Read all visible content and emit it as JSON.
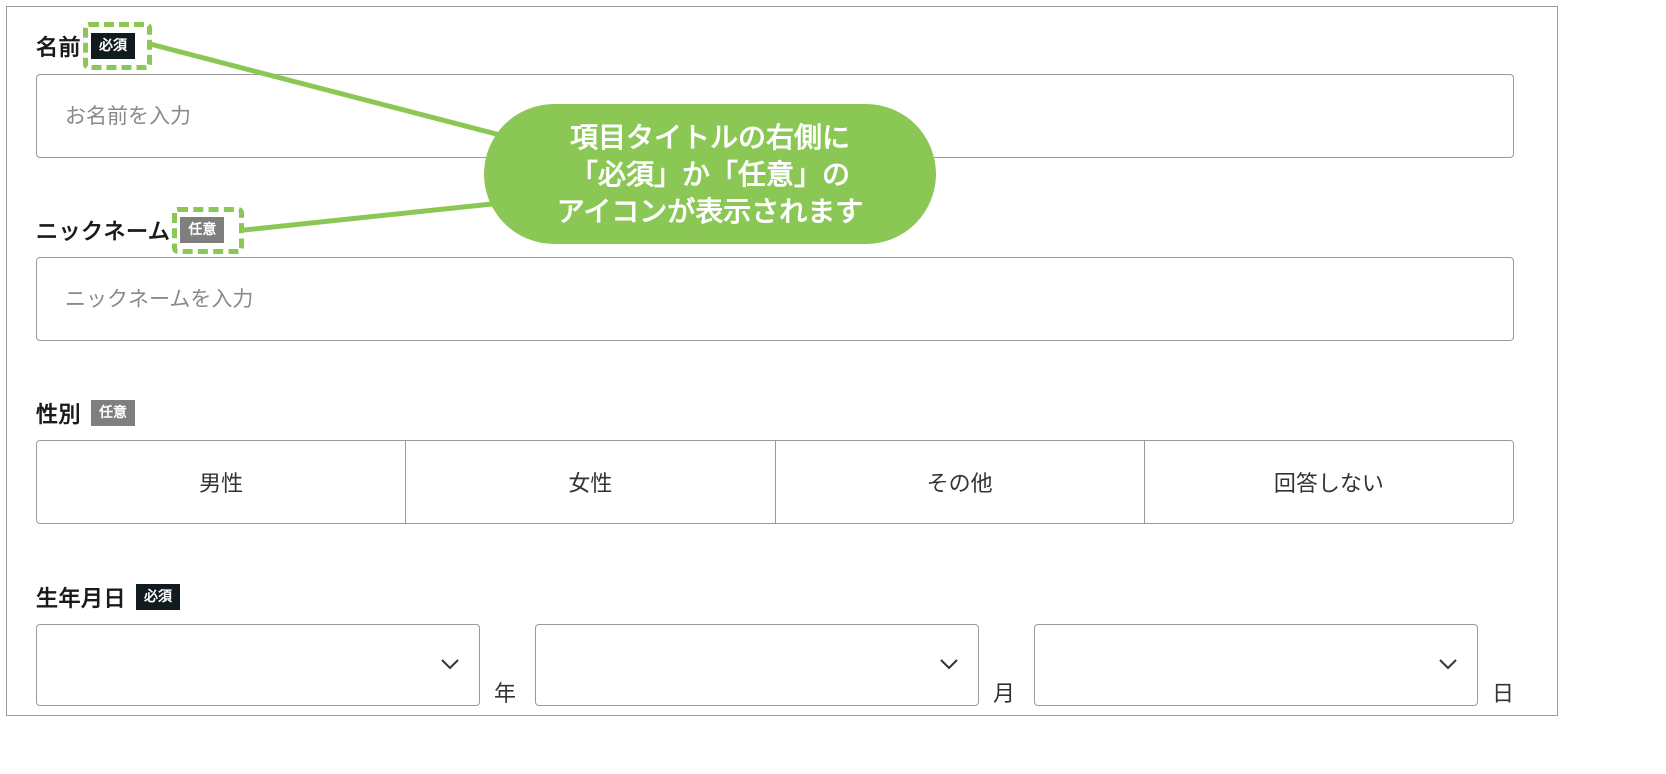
{
  "form": {
    "name": {
      "label": "名前",
      "badge": "必須",
      "placeholder": "お名前を入力"
    },
    "nickname": {
      "label": "ニックネーム",
      "badge": "任意",
      "placeholder": "ニックネームを入力"
    },
    "gender": {
      "label": "性別",
      "badge": "任意",
      "options": [
        "男性",
        "女性",
        "その他",
        "回答しない"
      ]
    },
    "birthday": {
      "label": "生年月日",
      "badge": "必須",
      "units": [
        "年",
        "月",
        "日"
      ]
    }
  },
  "annotation": {
    "lines": [
      "項目タイトルの右側に",
      "「必須」か「任意」の",
      "アイコンが表示されます"
    ]
  },
  "colors": {
    "required_badge": "#111a1f",
    "optional_badge": "#7f7f7f",
    "annotation": "#8bc755",
    "border": "#9a9a9a"
  },
  "icons": {
    "select": "chevron-down-icon"
  }
}
